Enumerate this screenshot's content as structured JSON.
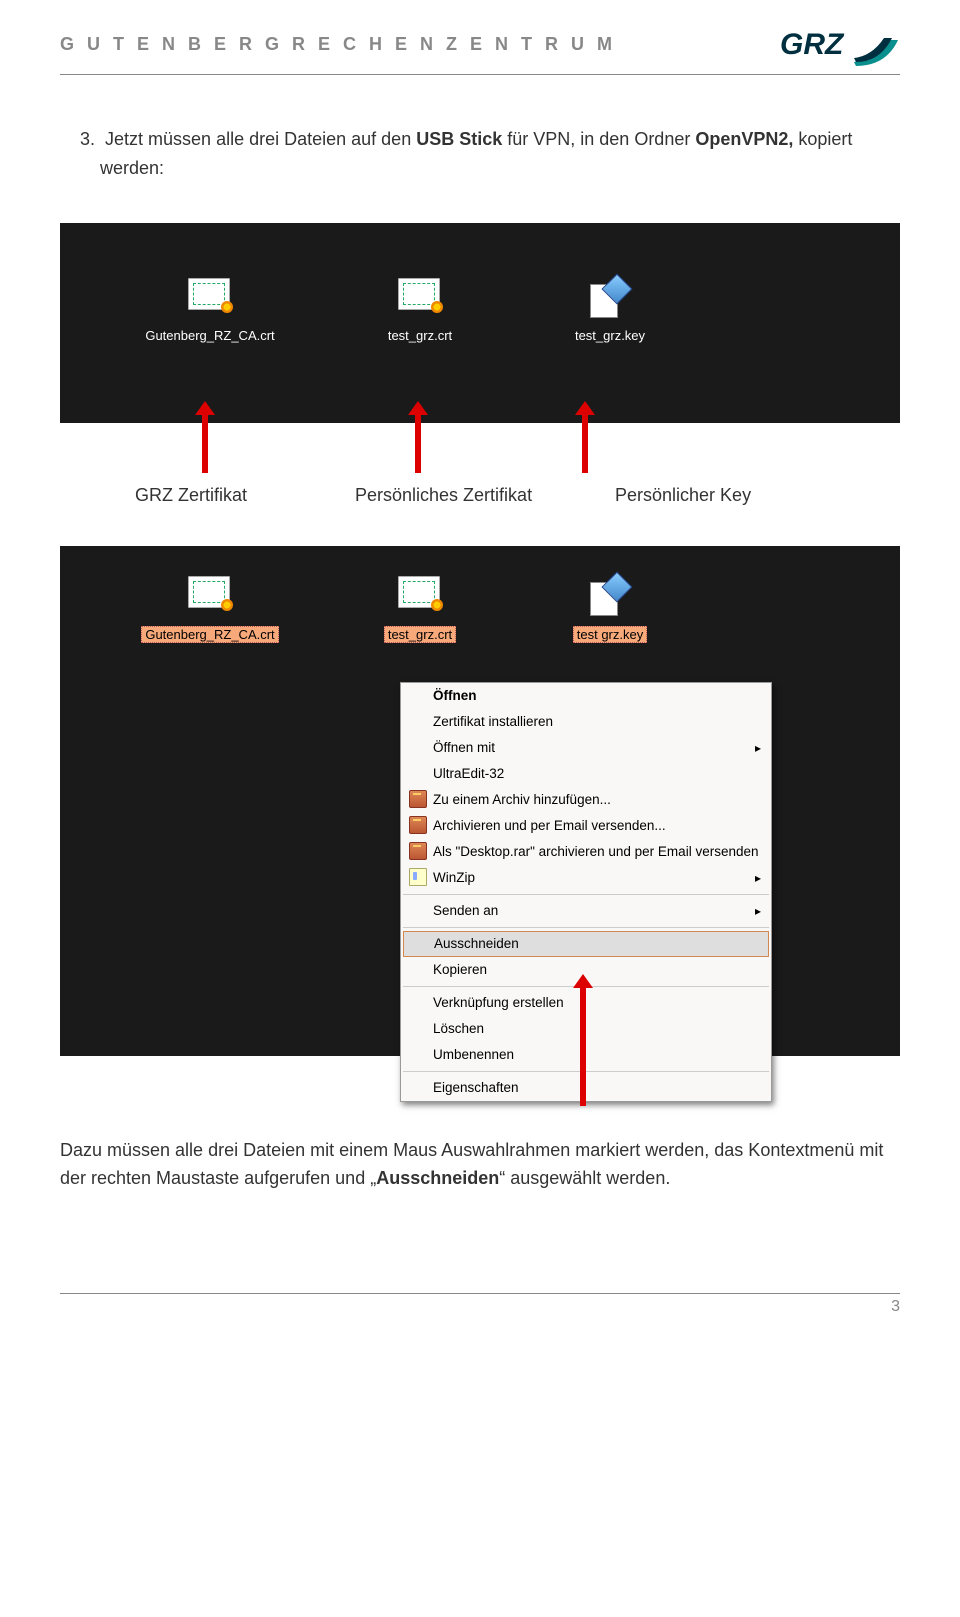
{
  "header": {
    "title": "G U T E N B E R G   R E C H E N Z E N T R U M"
  },
  "logo_text": "GRZ",
  "step_prefix": "3.",
  "step_line1_a": "Jetzt müssen alle drei Dateien auf den ",
  "step_line1_b": "USB Stick",
  "step_line1_c": " für VPN, in den Ordner ",
  "step_line1_d": "OpenVPN2,",
  "step_line1_e": " kopiert",
  "step_line2": "werden:",
  "panel1": {
    "file1": "Gutenberg_RZ_CA.crt",
    "file2": "test_grz.crt",
    "file3": "test_grz.key"
  },
  "labels": {
    "l1": "GRZ Zertifikat",
    "l2": "Persönliches Zertifikat",
    "l3": "Persönlicher Key"
  },
  "panel2": {
    "file1": "Gutenberg_RZ_CA.crt",
    "file2": "test_grz.crt",
    "file3": "test  grz.key"
  },
  "context_menu": {
    "m1": "Öffnen",
    "m2": "Zertifikat installieren",
    "m3": "Öffnen mit",
    "m4": "UltraEdit-32",
    "m5": "Zu einem Archiv hinzufügen...",
    "m6": "Archivieren und per Email versenden...",
    "m7": "Als \"Desktop.rar\" archivieren und per Email versenden",
    "m8": "WinZip",
    "m9": "Senden an",
    "m10": "Ausschneiden",
    "m11": "Kopieren",
    "m12": "Verknüpfung erstellen",
    "m13": "Löschen",
    "m14": "Umbenennen",
    "m15": "Eigenschaften"
  },
  "final_a": "Dazu müssen alle drei Dateien mit einem Maus Auswahlrahmen markiert werden, das Kontextmenü mit der rechten Maustaste aufgerufen und „",
  "final_b": "Ausschneiden",
  "final_c": "“ ausgewählt werden.",
  "page_number": "3"
}
